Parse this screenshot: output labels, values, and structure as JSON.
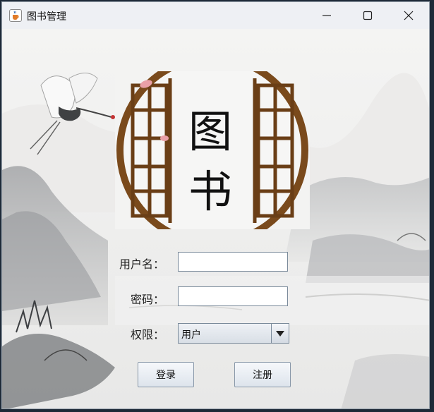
{
  "window": {
    "title": "图书管理",
    "icons": {
      "app": "java-cup-icon",
      "minimize": "minimize-icon",
      "maximize": "maximize-icon",
      "close": "close-icon"
    }
  },
  "logo": {
    "char_top": "图",
    "char_bottom": "书",
    "frame_color": "#7a4a1c"
  },
  "form": {
    "username_label": "用户名：",
    "username_value": "",
    "password_label": "密码：",
    "password_value": "",
    "role_label": "权限：",
    "role_selected": "用户"
  },
  "buttons": {
    "login": "登录",
    "register": "注册"
  },
  "colors": {
    "titlebar": "#eef0f4",
    "background": "#f0f0ef",
    "button_top": "#f6f8fb",
    "button_bottom": "#dde4ec",
    "field_border": "#7a8a9a"
  }
}
